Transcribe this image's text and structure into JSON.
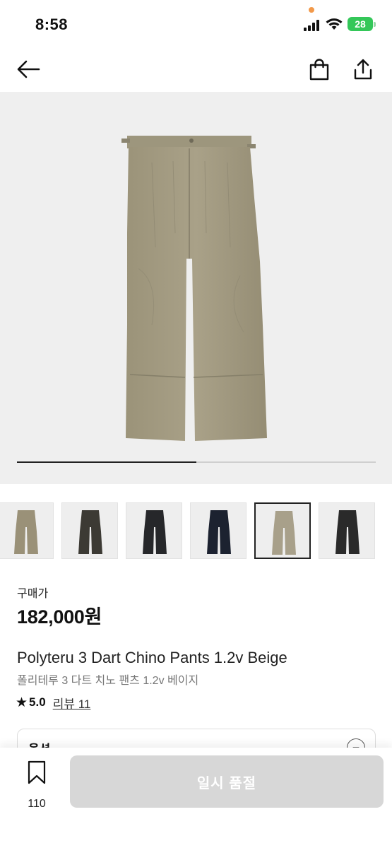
{
  "status_bar": {
    "time": "8:58",
    "battery": "28"
  },
  "gallery": {
    "progress": 0.5
  },
  "thumbnails": [
    {
      "color": "#9a9178",
      "name": "beige"
    },
    {
      "color": "#3c3a34",
      "name": "charcoal-brown"
    },
    {
      "color": "#26272a",
      "name": "black"
    },
    {
      "color": "#1c2230",
      "name": "navy"
    },
    {
      "color": "#a8a08a",
      "name": "beige",
      "selected": true
    },
    {
      "color": "#2a2a2a",
      "name": "black"
    }
  ],
  "product": {
    "price_label": "구매가",
    "price": "182,000원",
    "title_en": "Polyteru 3 Dart Chino Pants 1.2v Beige",
    "title_ko": "폴리테루 3 다트 치노 팬츠 1.2v 베이지",
    "rating": "5.0",
    "reviews": "리뷰 11"
  },
  "options": {
    "label": "옵션",
    "toggle": "−"
  },
  "bottom_bar": {
    "wish_count": "110",
    "cta_label": "일시 품절"
  },
  "colors": {
    "accent": "#111111",
    "cta_disabled": "#d7d7d7",
    "battery": "#34c759"
  },
  "icons": [
    "arrow-left-icon",
    "shopping-bag-icon",
    "share-icon",
    "bookmark-icon",
    "star-icon"
  ]
}
